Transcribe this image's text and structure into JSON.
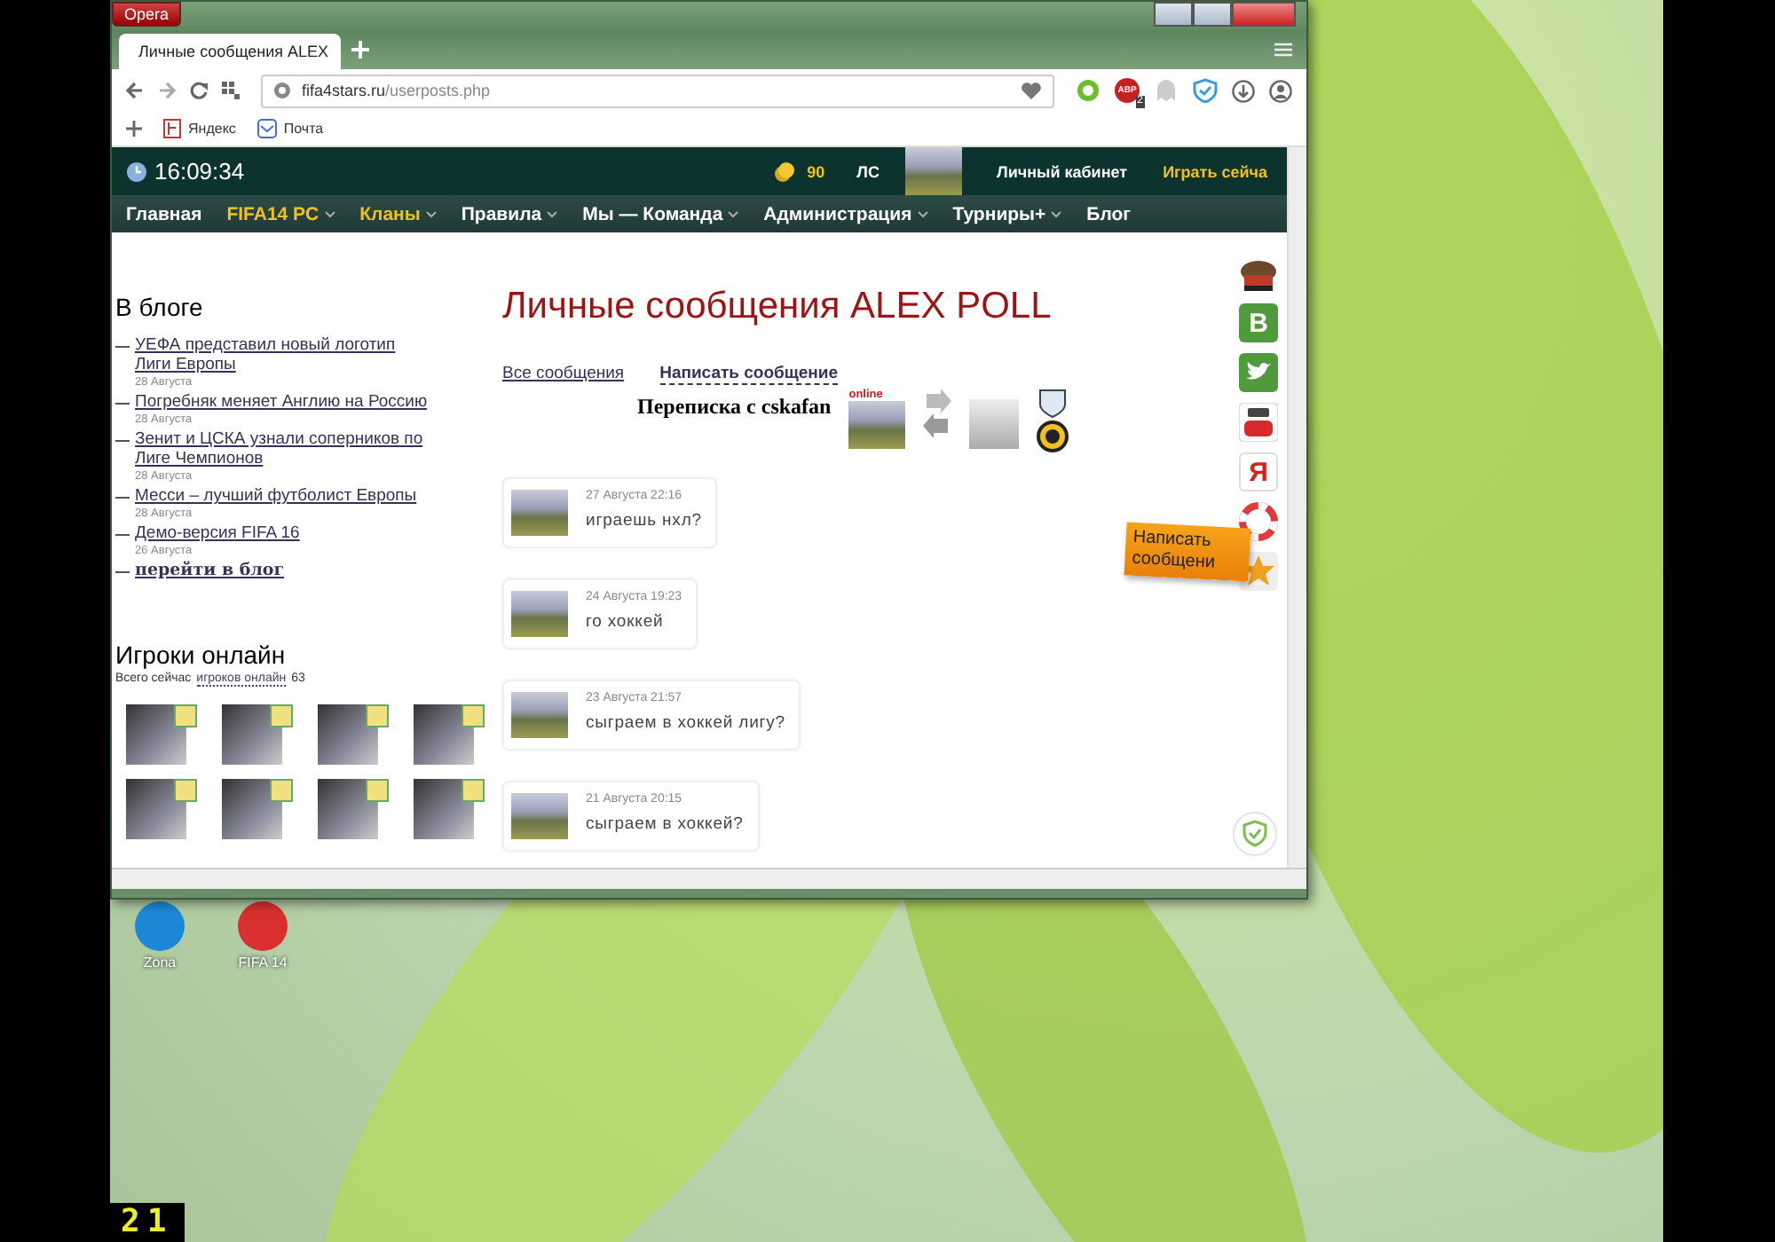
{
  "browser": {
    "app_button": "Opera",
    "tabs": [
      {
        "title": "Личные сообщения ALEX",
        "selected": true
      }
    ],
    "url": {
      "domain": "fifa4stars.ru",
      "path": "/userposts.php"
    },
    "extensions": [
      {
        "kind": "refresh"
      },
      {
        "kind": "adblock",
        "label": "ABP",
        "badge": "2"
      },
      {
        "kind": "ghost"
      },
      {
        "kind": "shield"
      }
    ],
    "bookmarks": [
      {
        "kind": "ya",
        "label": "Яндекс"
      },
      {
        "kind": "mail",
        "label": "Почта"
      }
    ]
  },
  "site": {
    "clock": "16:09:34",
    "coins": "90",
    "ls": "ЛС",
    "cabinet": "Личный кабинет",
    "play": "Играть сейча",
    "nav": [
      {
        "label": "Главная",
        "highlighted": false,
        "menu": false
      },
      {
        "label": "FIFA14 PC",
        "highlighted": true,
        "menu": true
      },
      {
        "label": "Кланы",
        "highlighted": true,
        "menu": true
      },
      {
        "label": "Правила",
        "highlighted": false,
        "menu": true
      },
      {
        "label": "Мы — Команда",
        "highlighted": false,
        "menu": true
      },
      {
        "label": "Администрация",
        "highlighted": false,
        "menu": true
      },
      {
        "label": "Турниры+",
        "highlighted": false,
        "menu": true
      },
      {
        "label": "Блог",
        "highlighted": false,
        "menu": false
      }
    ]
  },
  "blog": {
    "title": "В блоге",
    "posts": [
      {
        "title": "УЕФА представил новый логотип Лиги Европы",
        "date": "28 Августа"
      },
      {
        "title": "Погребняк меняет Англию на Россию",
        "date": "28 Августа"
      },
      {
        "title": "Зенит и ЦСКА узнали соперников по Лиге Чемпионов",
        "date": "28 Августа"
      },
      {
        "title": "Месси – лучший футболист Европы",
        "date": "28 Августа"
      },
      {
        "title": "Демо-версия FIFA 16",
        "date": "26 Августа"
      }
    ],
    "more": "перейти в блог"
  },
  "online": {
    "title": "Игроки онлайн",
    "prefix": "Всего сейчас",
    "link": "игроков онлайн",
    "count": "63"
  },
  "main": {
    "title": "Личные сообщения ALEX POLL",
    "tabs": [
      {
        "label": "Все сообщения",
        "selected": false
      },
      {
        "label": "Написать сообщение",
        "selected": true
      }
    ],
    "conversation": "Переписка с cskafan",
    "status": "online",
    "messages": [
      {
        "date": "27 Августа 22:16",
        "text": "играешь нхл?"
      },
      {
        "date": "24 Августа 19:23",
        "text": "го хоккей"
      },
      {
        "date": "23 Августа 21:57",
        "text": "сыграем в хоккей лигу?"
      },
      {
        "date": "21 Августа 20:15",
        "text": "сыграем в хоккей?"
      }
    ]
  },
  "social": [
    {
      "kind": "hat"
    },
    {
      "kind": "letter",
      "label": "B",
      "color": "#4f9a3c"
    },
    {
      "kind": "bird",
      "color": "#4f9a3c"
    },
    {
      "kind": "video"
    },
    {
      "kind": "letter",
      "label": "Я",
      "color": "#ffffff"
    },
    {
      "kind": "ring"
    },
    {
      "kind": "star"
    }
  ],
  "write_button": "Написать сообщени",
  "desktop": {
    "icons": [
      {
        "label": "Zona",
        "color": "#1e88d8"
      },
      {
        "label": "FIFA 14",
        "color": "#d83030"
      }
    ],
    "counter": "21"
  }
}
